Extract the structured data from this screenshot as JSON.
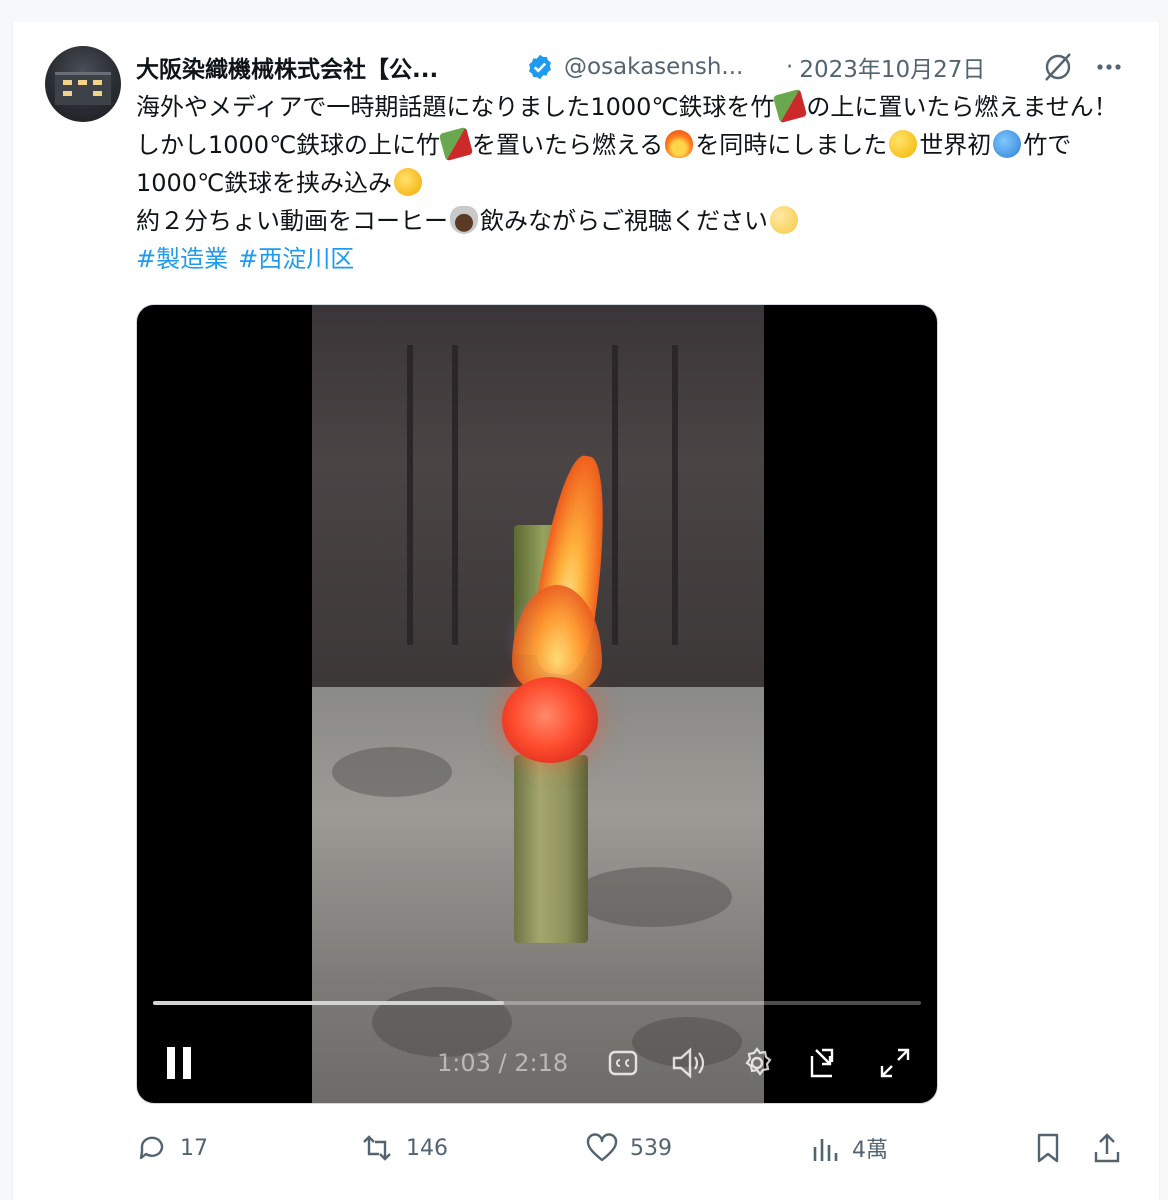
{
  "tweet": {
    "author_name": "大阪染織機械株式会社【公...",
    "handle": "@osakasensh...",
    "separator": "·",
    "date": "2023年10月27日",
    "text": {
      "seg1": "海外やメディアで一時期話題になりました1000℃鉄球を竹",
      "seg2": "の上に置いたら燃えません！しかし1000℃鉄球の上に竹",
      "seg3": "を置いたら燃える",
      "seg4": "を同時にしました",
      "seg5": "世界初",
      "seg6": "竹で1000℃鉄球を挟み込み",
      "line2": "約２分ちょい動画をコーヒー",
      "line2b": "飲みながらご視聴ください"
    },
    "hashtags": [
      "#製造業",
      "#西淀川区"
    ],
    "emojis": [
      "bamboo-chili",
      "fire",
      "sunglasses-face",
      "globe",
      "star-struck-face",
      "coffee",
      "relieved-face"
    ]
  },
  "video": {
    "current_time": "1:03",
    "duration": "2:18",
    "time_separator": " / ",
    "progress": 0.457
  },
  "actions": {
    "replies": "17",
    "reposts": "146",
    "likes": "539",
    "views": "4萬"
  },
  "colors": {
    "accent": "#1d9bf0",
    "text": "#0f1419",
    "secondary": "#536471"
  }
}
